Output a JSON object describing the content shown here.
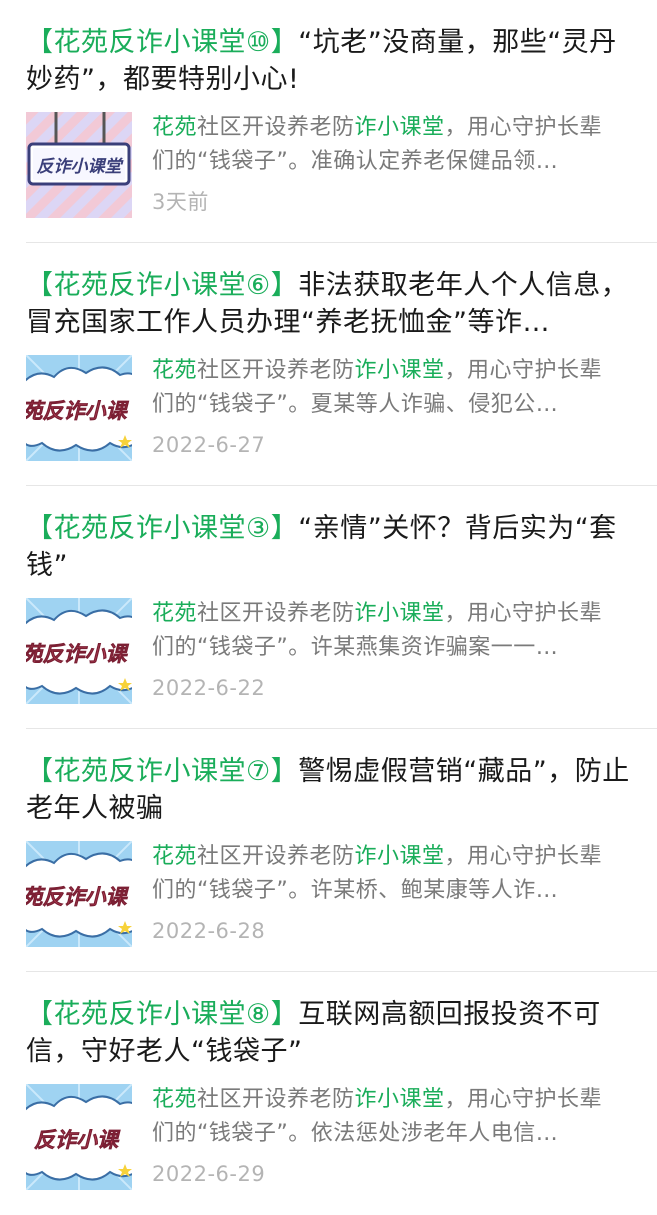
{
  "articles": [
    {
      "title_hl": "【花苑反诈小课堂⑩】",
      "title_rest": "“坑老”没商量，那些“灵丹妙药”，都要特别小心!",
      "snippet_a": "花苑",
      "snippet_b": "社区开设养老防",
      "snippet_c": "诈小课堂",
      "snippet_d": "，用心守护长辈们的“钱袋子”。准确认定养老保健品领…",
      "date": "3天前",
      "thumb_text": "反诈小课堂",
      "thumb_style": "board"
    },
    {
      "title_hl": "【花苑反诈小课堂⑥】",
      "title_rest": "非法获取老年人个人信息，冒充国家工作人员办理“养老抚恤金”等诈…",
      "snippet_a": "花苑",
      "snippet_b": "社区开设养老防",
      "snippet_c": "诈小课堂",
      "snippet_d": "，用心守护长辈们的“钱袋子”。夏某等人诈骗、侵犯公…",
      "date": "2022-6-27",
      "thumb_text": "苑反诈小课",
      "thumb_style": "cloud"
    },
    {
      "title_hl": "【花苑反诈小课堂③】",
      "title_rest": "“亲情”关怀？背后实为“套钱”",
      "snippet_a": "花苑",
      "snippet_b": "社区开设养老防",
      "snippet_c": "诈小课堂",
      "snippet_d": "，用心守护长辈们的“钱袋子”。许某燕集资诈骗案一一…",
      "date": "2022-6-22",
      "thumb_text": "苑反诈小课",
      "thumb_style": "cloud"
    },
    {
      "title_hl": "【花苑反诈小课堂⑦】",
      "title_rest": "警惕虚假营销“藏品”，防止老年人被骗",
      "snippet_a": "花苑",
      "snippet_b": "社区开设养老防",
      "snippet_c": "诈小课堂",
      "snippet_d": "，用心守护长辈们的“钱袋子”。许某桥、鲍某康等人诈…",
      "date": "2022-6-28",
      "thumb_text": "苑反诈小课",
      "thumb_style": "cloud"
    },
    {
      "title_hl": "【花苑反诈小课堂⑧】",
      "title_rest": "互联网高额回报投资不可信，守好老人“钱袋子”",
      "snippet_a": "花苑",
      "snippet_b": "社区开设养老防",
      "snippet_c": "诈小课堂",
      "snippet_d": "，用心守护长辈们的“钱袋子”。依法惩处涉老年人电信…",
      "date": "2022-6-29",
      "thumb_text": "反诈小课",
      "thumb_style": "cloud"
    }
  ],
  "colors": {
    "accent": "#1aad5a",
    "title": "#1a1a1a",
    "snippet": "#7a7a7a",
    "date": "#b4b4b4",
    "divider": "#e6e6e6"
  }
}
